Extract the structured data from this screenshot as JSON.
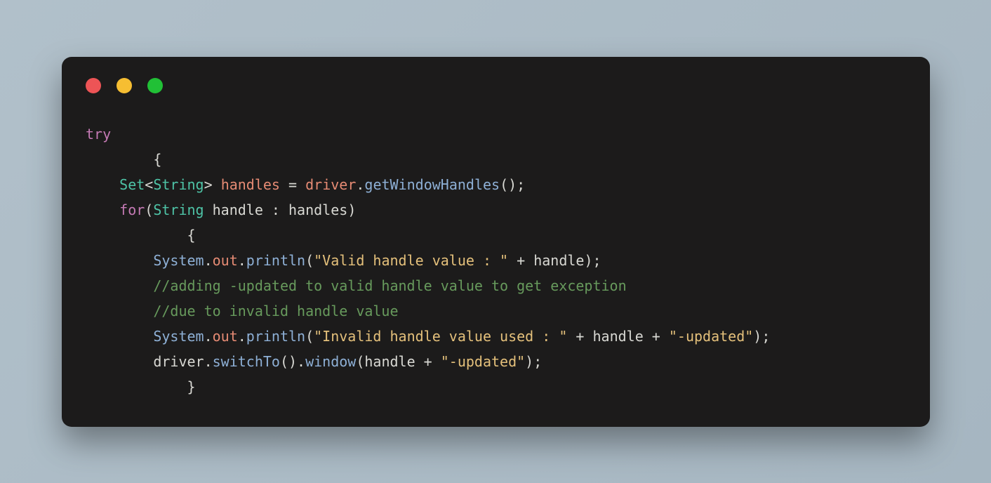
{
  "code": {
    "try": "try",
    "brace1": "        {",
    "l3": {
      "pad": "    ",
      "Set": "Set",
      "lt": "<",
      "String": "String",
      "gt": "> ",
      "handles": "handles",
      "eq": " = ",
      "driver": "driver",
      "dot": ".",
      "getWH": "getWindowHandles",
      "paren": "();"
    },
    "l4": {
      "pad": "    ",
      "for": "for",
      "open": "(",
      "String": "String",
      "handle": " handle",
      "colon": " : ",
      "handles": "handles",
      "close": ")"
    },
    "brace2": "            {",
    "l6": {
      "pad": "        ",
      "System": "System",
      "dot1": ".",
      "out": "out",
      "dot2": ".",
      "println": "println",
      "open": "(",
      "str": "\"Valid handle value : \"",
      "plus": " + ",
      "handle": "handle",
      "close": ");"
    },
    "l7": "        //adding -updated to valid handle value to get exception",
    "l8": "        //due to invalid handle value",
    "l9": {
      "pad": "        ",
      "System": "System",
      "dot1": ".",
      "out": "out",
      "dot2": ".",
      "println": "println",
      "open": "(",
      "str1": "\"Invalid handle value used : \"",
      "plus1": " + ",
      "handle": "handle",
      "plus2": " + ",
      "str2": "\"-updated\"",
      "close": ");"
    },
    "l10": {
      "pad": "        ",
      "driver": "driver",
      "dot1": ".",
      "switchTo": "switchTo",
      "paren1": "().",
      "window": "window",
      "open": "(",
      "handle": "handle",
      "plus": " + ",
      "str": "\"-updated\"",
      "close": ");"
    },
    "brace3": "            }"
  }
}
